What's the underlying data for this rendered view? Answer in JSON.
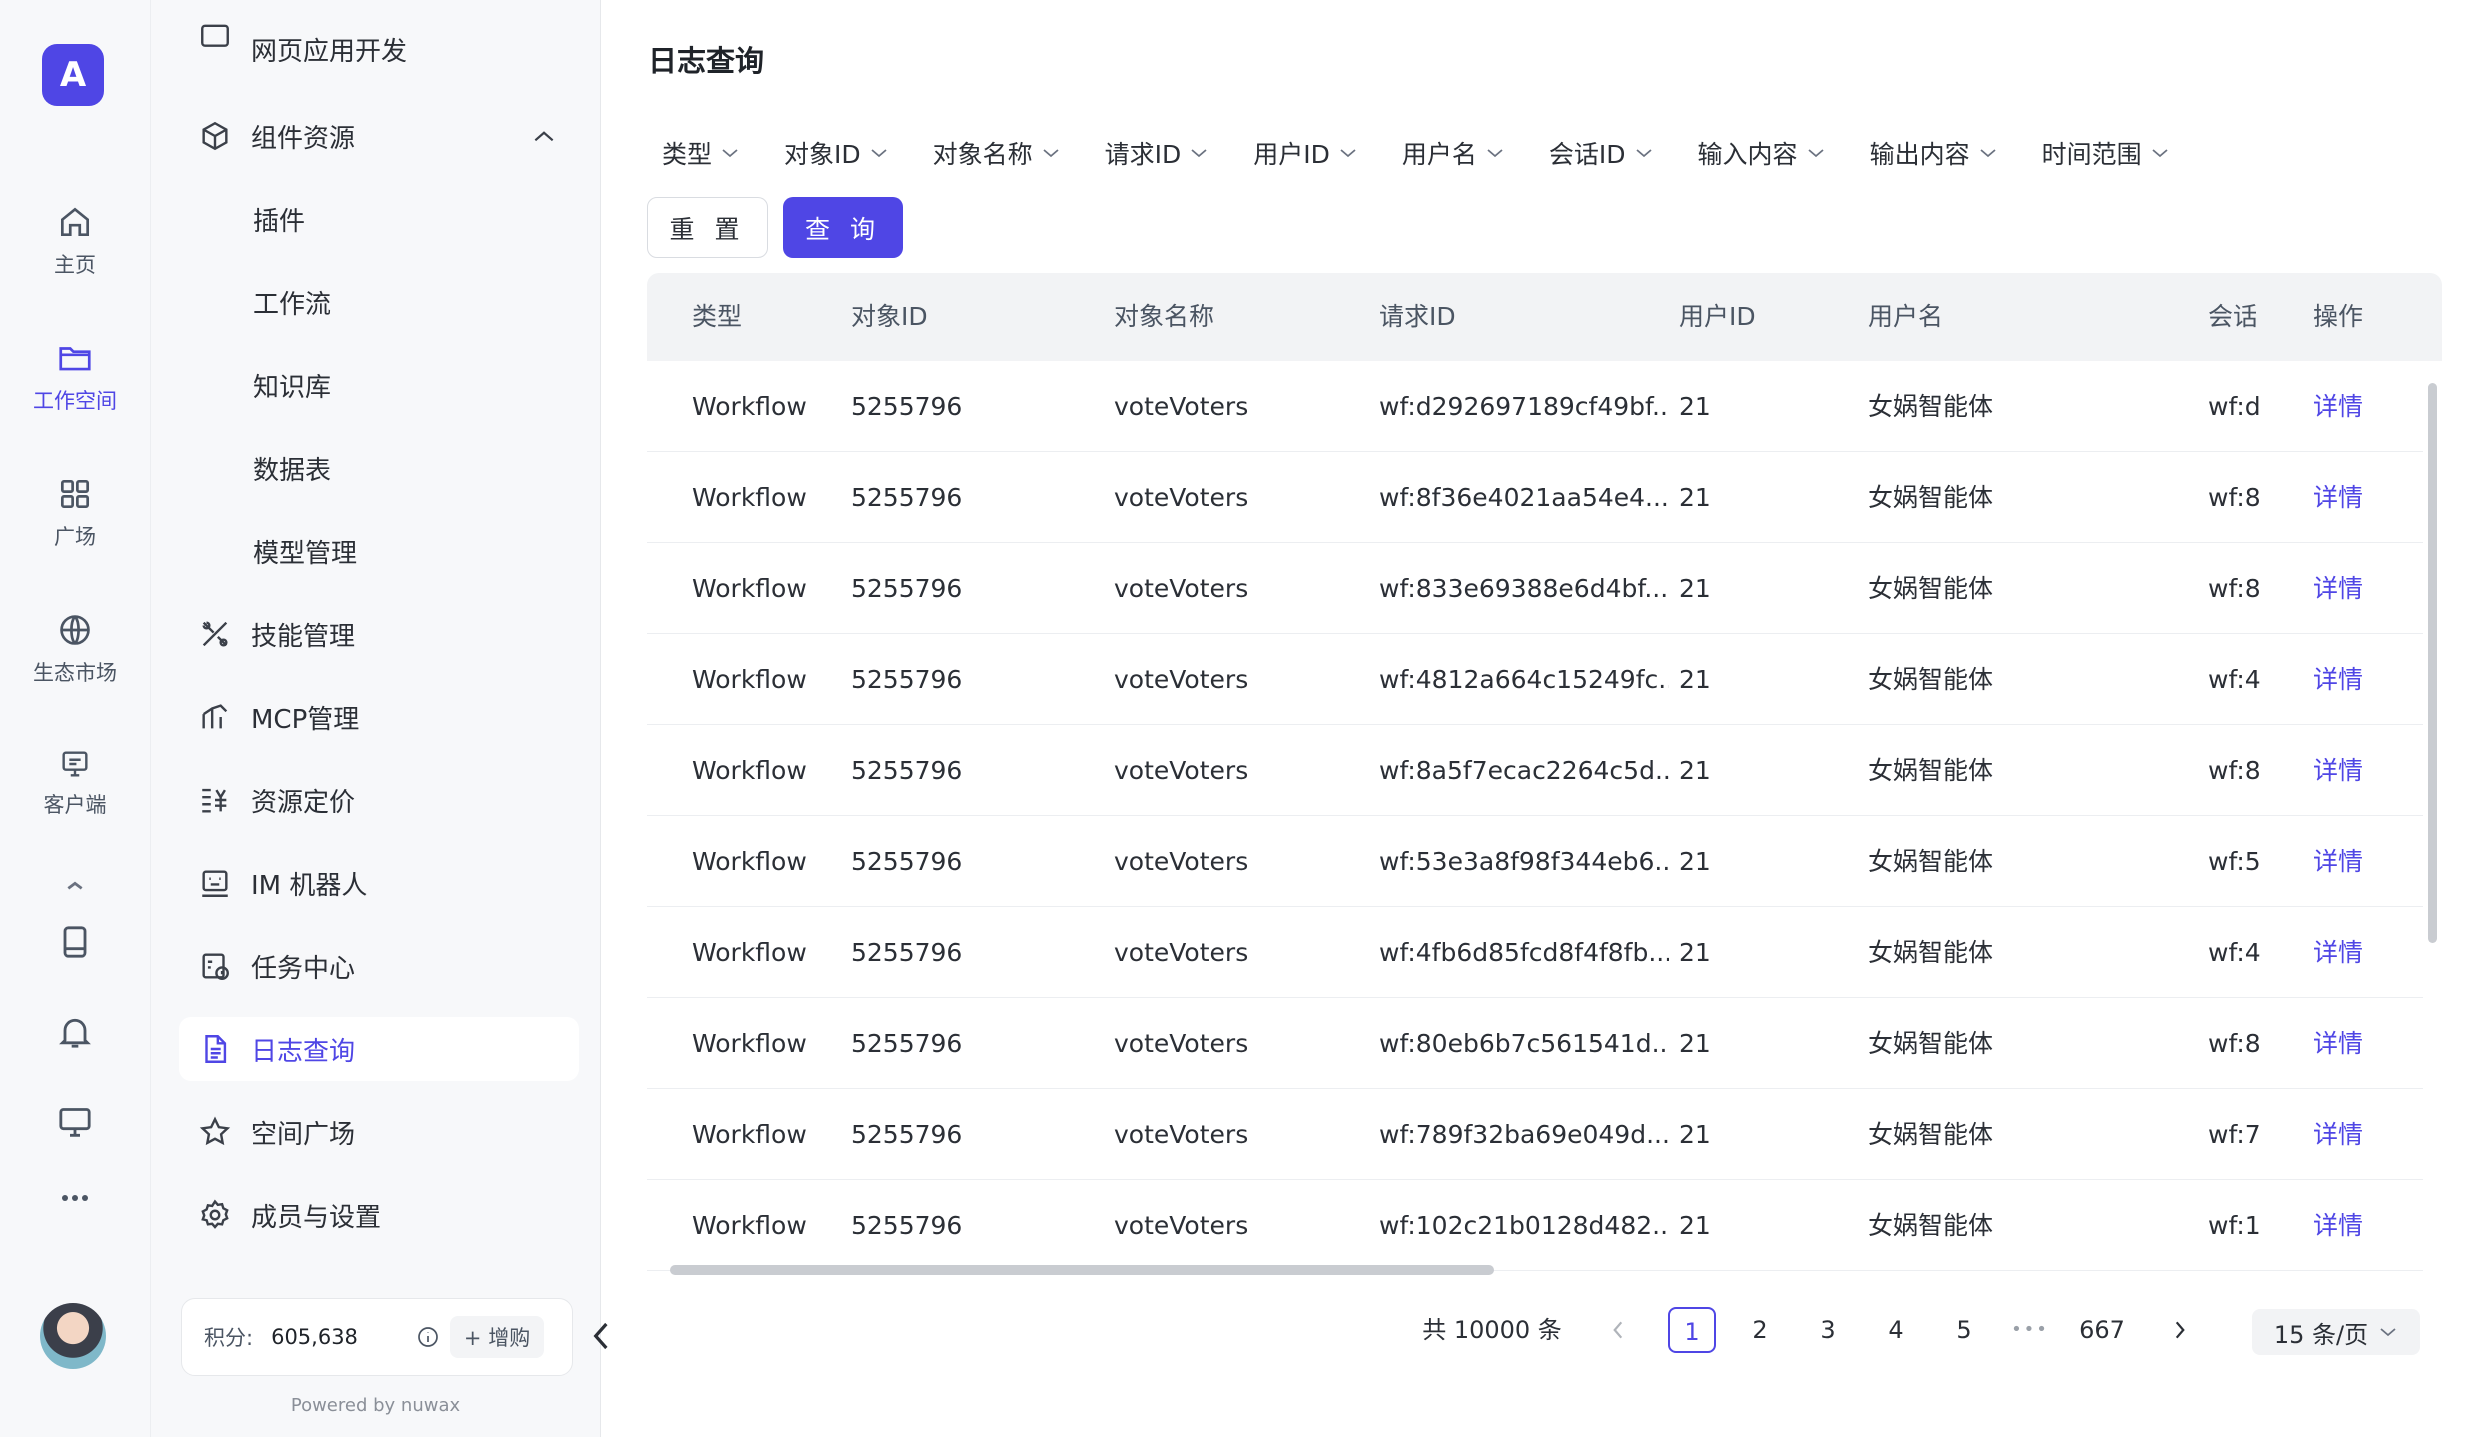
{
  "rail": {
    "logo": "A",
    "items": [
      {
        "label": "主页",
        "icon": "home-icon"
      },
      {
        "label": "工作空间",
        "icon": "folder-icon",
        "active": true
      },
      {
        "label": "广场",
        "icon": "grid-icon"
      },
      {
        "label": "生态市场",
        "icon": "globe-icon"
      },
      {
        "label": "客户端",
        "icon": "monitor-icon"
      }
    ],
    "bottom_icons": [
      "book-icon",
      "bell-icon",
      "desktop-icon",
      "more-icon"
    ]
  },
  "sidebar": {
    "top_partial": "网页应用开发",
    "group": "组件资源",
    "sub_items": [
      "插件",
      "工作流",
      "知识库",
      "数据表",
      "模型管理"
    ],
    "items": [
      {
        "label": "技能管理",
        "icon": "tools-icon"
      },
      {
        "label": "MCP管理",
        "icon": "mcp-icon"
      },
      {
        "label": "资源定价",
        "icon": "pricing-icon"
      },
      {
        "label": "IM 机器人",
        "icon": "robot-icon"
      },
      {
        "label": "任务中心",
        "icon": "task-icon"
      },
      {
        "label": "日志查询",
        "icon": "log-icon",
        "active": true
      },
      {
        "label": "空间广场",
        "icon": "star-icon"
      },
      {
        "label": "成员与设置",
        "icon": "settings-icon"
      }
    ],
    "credits_label": "积分:",
    "credits_value": "605,638",
    "buy_label": "+ 增购",
    "powered_by": "Powered by nuwax"
  },
  "main": {
    "title": "日志查询",
    "filters": [
      "类型",
      "对象ID",
      "对象名称",
      "请求ID",
      "用户ID",
      "用户名",
      "会话ID",
      "输入内容",
      "输出内容",
      "时间范围"
    ],
    "reset_label": "重 置",
    "query_label": "查 询"
  },
  "table": {
    "columns": [
      "类型",
      "对象ID",
      "对象名称",
      "请求ID",
      "用户ID",
      "用户名",
      "会话",
      "操作"
    ],
    "rows": [
      [
        "Workflow",
        "5255796",
        "voteVoters",
        "wf:d292697189cf49bf...",
        "21",
        "女娲智能体",
        "wf:d",
        "详情"
      ],
      [
        "Workflow",
        "5255796",
        "voteVoters",
        "wf:8f36e4021aa54e4...",
        "21",
        "女娲智能体",
        "wf:8",
        "详情"
      ],
      [
        "Workflow",
        "5255796",
        "voteVoters",
        "wf:833e69388e6d4bf...",
        "21",
        "女娲智能体",
        "wf:8",
        "详情"
      ],
      [
        "Workflow",
        "5255796",
        "voteVoters",
        "wf:4812a664c15249fc...",
        "21",
        "女娲智能体",
        "wf:4",
        "详情"
      ],
      [
        "Workflow",
        "5255796",
        "voteVoters",
        "wf:8a5f7ecac2264c5d...",
        "21",
        "女娲智能体",
        "wf:8",
        "详情"
      ],
      [
        "Workflow",
        "5255796",
        "voteVoters",
        "wf:53e3a8f98f344eb6...",
        "21",
        "女娲智能体",
        "wf:5",
        "详情"
      ],
      [
        "Workflow",
        "5255796",
        "voteVoters",
        "wf:4fb6d85fcd8f4f8fb...",
        "21",
        "女娲智能体",
        "wf:4",
        "详情"
      ],
      [
        "Workflow",
        "5255796",
        "voteVoters",
        "wf:80eb6b7c561541d...",
        "21",
        "女娲智能体",
        "wf:8",
        "详情"
      ],
      [
        "Workflow",
        "5255796",
        "voteVoters",
        "wf:789f32ba69e049d...",
        "21",
        "女娲智能体",
        "wf:7",
        "详情"
      ],
      [
        "Workflow",
        "5255796",
        "voteVoters",
        "wf:102c21b0128d482...",
        "21",
        "女娲智能体",
        "wf:1",
        "详情"
      ]
    ]
  },
  "pagination": {
    "total": "共 10000 条",
    "pages": [
      "1",
      "2",
      "3",
      "4",
      "5"
    ],
    "ellipsis": "•••",
    "last_page": "667",
    "current": "1",
    "page_size": "15 条/页"
  },
  "colors": {
    "accent": "#4f46e5",
    "header_bg": "#f2f3f5",
    "sidebar_bg": "#f7f8fa"
  }
}
